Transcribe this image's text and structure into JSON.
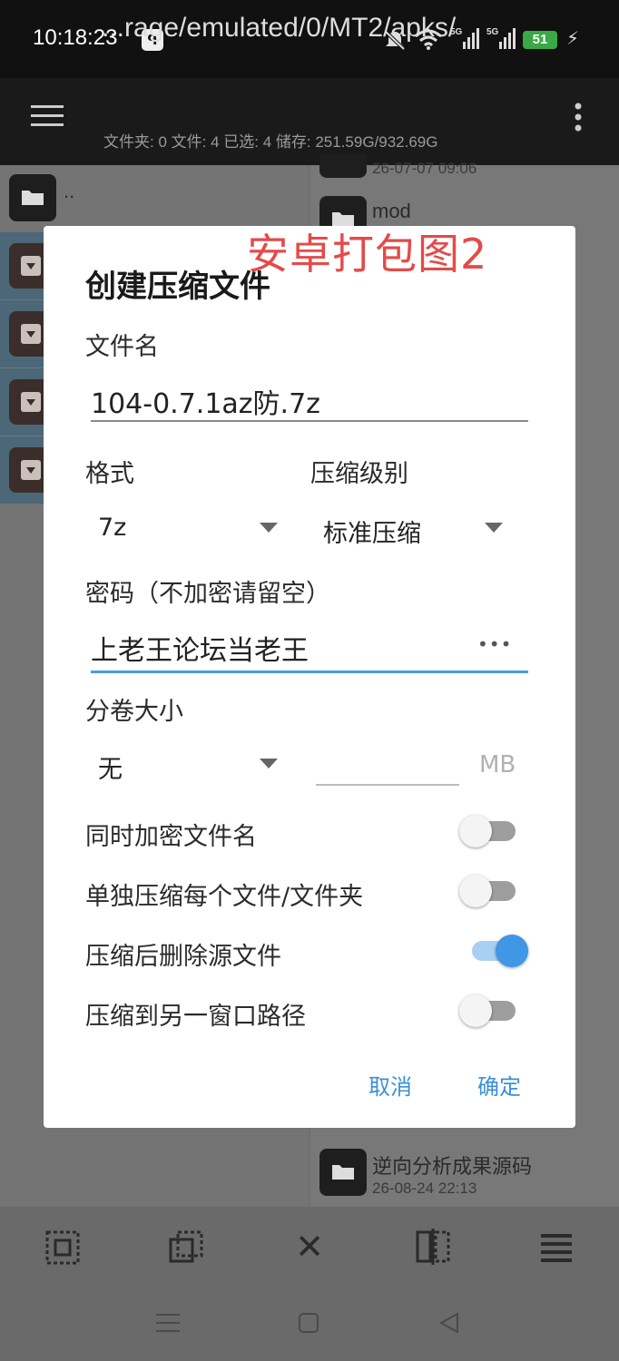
{
  "status_bar": {
    "time": "10:18:23",
    "app_icon": "ᑫ",
    "battery": "51",
    "network": "5G"
  },
  "toolbar": {
    "path": "...rage/emulated/0/MT2/apks/",
    "info": "文件夹: 0  文件: 4  已选: 4  储存: 251.59G/932.69G"
  },
  "left_panel": {
    "parent_label": ".."
  },
  "right_panel": {
    "top_date": "26-07-07 09:06",
    "mod_label": "mod",
    "bottom_item_name": "逆向分析成果源码",
    "bottom_item_date": "26-08-24 22:13"
  },
  "watermark": "安卓打包图2",
  "dialog": {
    "title": "创建压缩文件",
    "filename_label": "文件名",
    "filename_value": "104-0.7.1az防.7z",
    "format_label": "格式",
    "format_value": "7z",
    "level_label": "压缩级别",
    "level_value": "标准压缩",
    "password_label": "密码（不加密请留空）",
    "password_value": "上老王论坛当老王",
    "password_toggle": "•••",
    "volume_label": "分卷大小",
    "volume_value": "无",
    "volume_unit": "MB",
    "toggles": [
      {
        "label": "同时加密文件名",
        "on": false
      },
      {
        "label": "单独压缩每个文件/文件夹",
        "on": false
      },
      {
        "label": "压缩后删除源文件",
        "on": true
      },
      {
        "label": "压缩到另一窗口路径",
        "on": false
      }
    ],
    "cancel": "取消",
    "confirm": "确定"
  },
  "colors": {
    "accent": "#3a8fd8",
    "watermark": "#e54a4a",
    "switch_on": "#3f97e6"
  }
}
